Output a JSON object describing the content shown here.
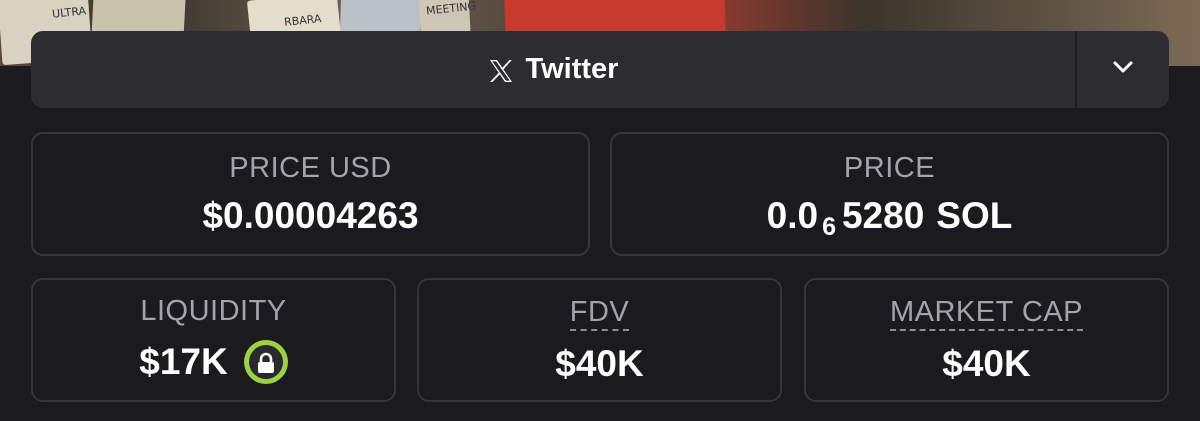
{
  "dropdown": {
    "label": "Twitter",
    "icon": "x-logo-icon",
    "toggle_icon": "chevron-down-icon"
  },
  "price_usd": {
    "label": "PRICE USD",
    "value": "$0.00004263"
  },
  "price_sol": {
    "label": "PRICE",
    "value_prefix": "0.0",
    "value_subscript": "6",
    "value_digits": "5280",
    "value_unit": "SOL"
  },
  "liquidity": {
    "label": "LIQUIDITY",
    "value": "$17K",
    "badge_icon": "lock-icon",
    "badge_color": "#9bd143"
  },
  "fdv": {
    "label": "FDV",
    "value": "$40K"
  },
  "market_cap": {
    "label": "MARKET CAP",
    "value": "$40K"
  },
  "banner": {
    "texts": [
      "ULTRA",
      "RBARA",
      "MEETING"
    ]
  }
}
